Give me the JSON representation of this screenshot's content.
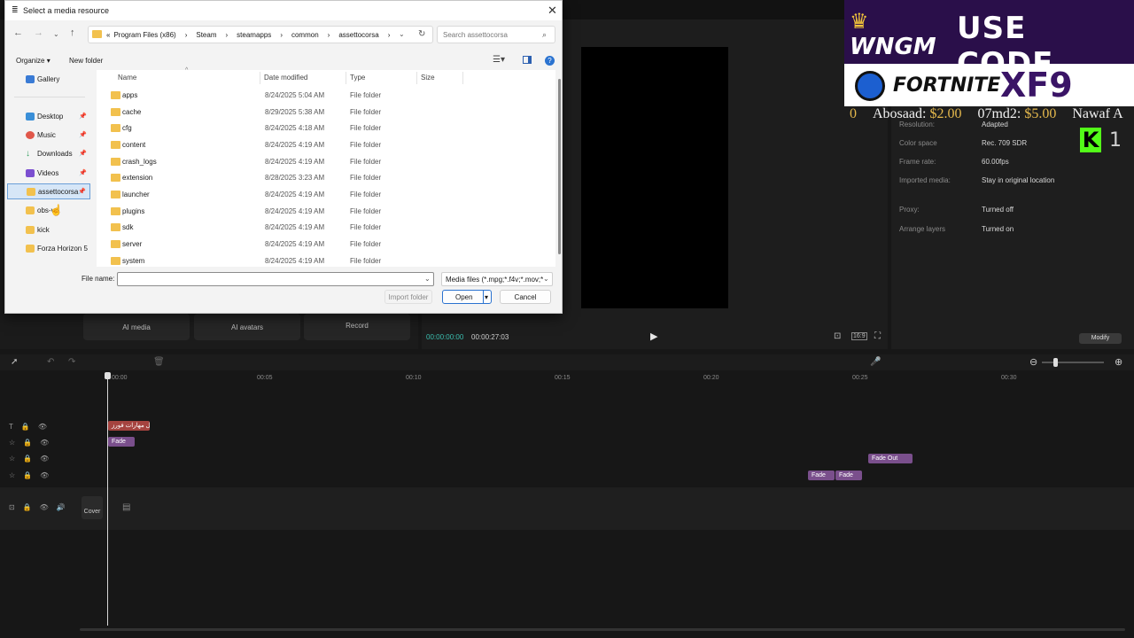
{
  "dialog": {
    "title": "Select a media resource",
    "breadcrumbs": [
      "Program Files (x86)",
      "Steam",
      "steamapps",
      "common",
      "assettocorsa"
    ],
    "search_placeholder": "Search assettocorsa",
    "organize_label": "Organize",
    "new_folder_label": "New folder",
    "sidebar": [
      {
        "label": "Gallery",
        "color": "#3a7bd5"
      },
      {
        "label": "Desktop",
        "color": "#3a8fd8"
      },
      {
        "label": "Music",
        "color": "#e0574a"
      },
      {
        "label": "Downloads",
        "color": "#2e9c5a"
      },
      {
        "label": "Videos",
        "color": "#7b4fd0"
      },
      {
        "label": "assettocorsa",
        "color": "#f2c14e",
        "selected": true
      },
      {
        "label": "obs-vd",
        "color": "#f2c14e"
      },
      {
        "label": "kick",
        "color": "#f2c14e"
      },
      {
        "label": "Forza Horizon 5",
        "color": "#f2c14e"
      }
    ],
    "columns": [
      "Name",
      "Date modified",
      "Type",
      "Size"
    ],
    "files": [
      {
        "name": "apps",
        "date": "8/24/2025 5:04 AM",
        "type": "File folder"
      },
      {
        "name": "cache",
        "date": "8/29/2025 5:38 AM",
        "type": "File folder"
      },
      {
        "name": "cfg",
        "date": "8/24/2025 4:18 AM",
        "type": "File folder"
      },
      {
        "name": "content",
        "date": "8/24/2025 4:19 AM",
        "type": "File folder"
      },
      {
        "name": "crash_logs",
        "date": "8/24/2025 4:19 AM",
        "type": "File folder"
      },
      {
        "name": "extension",
        "date": "8/28/2025 3:23 AM",
        "type": "File folder"
      },
      {
        "name": "launcher",
        "date": "8/24/2025 4:19 AM",
        "type": "File folder"
      },
      {
        "name": "plugins",
        "date": "8/24/2025 4:19 AM",
        "type": "File folder"
      },
      {
        "name": "sdk",
        "date": "8/24/2025 4:19 AM",
        "type": "File folder"
      },
      {
        "name": "server",
        "date": "8/24/2025 4:19 AM",
        "type": "File folder"
      },
      {
        "name": "system",
        "date": "8/24/2025 4:19 AM",
        "type": "File folder"
      }
    ],
    "file_name_label": "File name:",
    "file_name_value": "",
    "filter_value": "Media files (*.mpg;*.f4v;*.mov;*",
    "import_folder_label": "Import folder",
    "open_label": "Open",
    "cancel_label": "Cancel"
  },
  "editor": {
    "tiles": [
      "AI media",
      "AI avatars",
      "Record"
    ],
    "timecode_current": "00:00:00:00",
    "timecode_total": "00:00:27:03",
    "properties": [
      {
        "label": "Resolution:",
        "value": "Adapted"
      },
      {
        "label": "Color space",
        "value": "Rec. 709 SDR"
      },
      {
        "label": "Frame rate:",
        "value": "60.00fps"
      },
      {
        "label": "Imported media:",
        "value": "Stay in original location"
      },
      {
        "label": "Proxy:",
        "value": "Turned off"
      },
      {
        "label": "Arrange layers",
        "value": "Turned on"
      }
    ],
    "modify_label": "Modify",
    "ruler": [
      "00:00",
      "00:05",
      "00:10",
      "00:15",
      "00:20",
      "00:25",
      "00:30"
    ],
    "clips": {
      "text_clip": "أفضل مهارات فورز",
      "fade1": "Fade",
      "fade_out": "Fade Out",
      "fade2": "Fade",
      "fade3": "Fade"
    },
    "cover_label": "Cover"
  },
  "overlay": {
    "use_code": "USE CODE",
    "brand": "WNGM",
    "game": "FORTNITE",
    "code": "XF9",
    "donation_ticker": {
      "lead": "0",
      "entries": [
        {
          "name": "Abosaad:",
          "amount": "$2.00"
        },
        {
          "name": "07md2:",
          "amount": "$5.00"
        },
        {
          "name": "Nawaf A",
          "amount": ""
        }
      ]
    },
    "kick_count": "1"
  }
}
